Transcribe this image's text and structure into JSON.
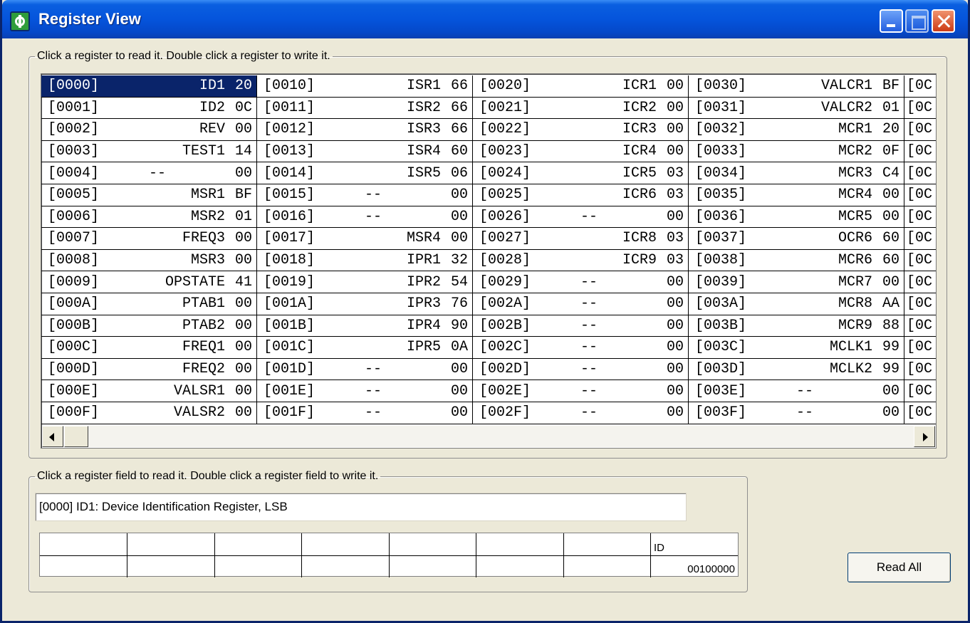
{
  "window": {
    "title": "Register View"
  },
  "register_group": {
    "caption": "Click a register to read it.  Double click a register to write it."
  },
  "registers": {
    "col1": [
      {
        "addr": "[0000]",
        "name": "ID1",
        "val": "20"
      },
      {
        "addr": "[0001]",
        "name": "ID2",
        "val": "0C"
      },
      {
        "addr": "[0002]",
        "name": "REV",
        "val": "00"
      },
      {
        "addr": "[0003]",
        "name": "TEST1",
        "val": "14"
      },
      {
        "addr": "[0004]",
        "name": "--",
        "val": "00"
      },
      {
        "addr": "[0005]",
        "name": "MSR1",
        "val": "BF"
      },
      {
        "addr": "[0006]",
        "name": "MSR2",
        "val": "01"
      },
      {
        "addr": "[0007]",
        "name": "FREQ3",
        "val": "00"
      },
      {
        "addr": "[0008]",
        "name": "MSR3",
        "val": "00"
      },
      {
        "addr": "[0009]",
        "name": "OPSTATE",
        "val": "41"
      },
      {
        "addr": "[000A]",
        "name": "PTAB1",
        "val": "00"
      },
      {
        "addr": "[000B]",
        "name": "PTAB2",
        "val": "00"
      },
      {
        "addr": "[000C]",
        "name": "FREQ1",
        "val": "00"
      },
      {
        "addr": "[000D]",
        "name": "FREQ2",
        "val": "00"
      },
      {
        "addr": "[000E]",
        "name": "VALSR1",
        "val": "00"
      },
      {
        "addr": "[000F]",
        "name": "VALSR2",
        "val": "00"
      }
    ],
    "col2": [
      {
        "addr": "[0010]",
        "name": "ISR1",
        "val": "66"
      },
      {
        "addr": "[0011]",
        "name": "ISR2",
        "val": "66"
      },
      {
        "addr": "[0012]",
        "name": "ISR3",
        "val": "66"
      },
      {
        "addr": "[0013]",
        "name": "ISR4",
        "val": "60"
      },
      {
        "addr": "[0014]",
        "name": "ISR5",
        "val": "06"
      },
      {
        "addr": "[0015]",
        "name": "--",
        "val": "00"
      },
      {
        "addr": "[0016]",
        "name": "--",
        "val": "00"
      },
      {
        "addr": "[0017]",
        "name": "MSR4",
        "val": "00"
      },
      {
        "addr": "[0018]",
        "name": "IPR1",
        "val": "32"
      },
      {
        "addr": "[0019]",
        "name": "IPR2",
        "val": "54"
      },
      {
        "addr": "[001A]",
        "name": "IPR3",
        "val": "76"
      },
      {
        "addr": "[001B]",
        "name": "IPR4",
        "val": "90"
      },
      {
        "addr": "[001C]",
        "name": "IPR5",
        "val": "0A"
      },
      {
        "addr": "[001D]",
        "name": "--",
        "val": "00"
      },
      {
        "addr": "[001E]",
        "name": "--",
        "val": "00"
      },
      {
        "addr": "[001F]",
        "name": "--",
        "val": "00"
      }
    ],
    "col3": [
      {
        "addr": "[0020]",
        "name": "ICR1",
        "val": "00"
      },
      {
        "addr": "[0021]",
        "name": "ICR2",
        "val": "00"
      },
      {
        "addr": "[0022]",
        "name": "ICR3",
        "val": "00"
      },
      {
        "addr": "[0023]",
        "name": "ICR4",
        "val": "00"
      },
      {
        "addr": "[0024]",
        "name": "ICR5",
        "val": "03"
      },
      {
        "addr": "[0025]",
        "name": "ICR6",
        "val": "03"
      },
      {
        "addr": "[0026]",
        "name": "--",
        "val": "00"
      },
      {
        "addr": "[0027]",
        "name": "ICR8",
        "val": "03"
      },
      {
        "addr": "[0028]",
        "name": "ICR9",
        "val": "03"
      },
      {
        "addr": "[0029]",
        "name": "--",
        "val": "00"
      },
      {
        "addr": "[002A]",
        "name": "--",
        "val": "00"
      },
      {
        "addr": "[002B]",
        "name": "--",
        "val": "00"
      },
      {
        "addr": "[002C]",
        "name": "--",
        "val": "00"
      },
      {
        "addr": "[002D]",
        "name": "--",
        "val": "00"
      },
      {
        "addr": "[002E]",
        "name": "--",
        "val": "00"
      },
      {
        "addr": "[002F]",
        "name": "--",
        "val": "00"
      }
    ],
    "col4": [
      {
        "addr": "[0030]",
        "name": "VALCR1",
        "val": "BF"
      },
      {
        "addr": "[0031]",
        "name": "VALCR2",
        "val": "01"
      },
      {
        "addr": "[0032]",
        "name": "MCR1",
        "val": "20"
      },
      {
        "addr": "[0033]",
        "name": "MCR2",
        "val": "0F"
      },
      {
        "addr": "[0034]",
        "name": "MCR3",
        "val": "C4"
      },
      {
        "addr": "[0035]",
        "name": "MCR4",
        "val": "00"
      },
      {
        "addr": "[0036]",
        "name": "MCR5",
        "val": "00"
      },
      {
        "addr": "[0037]",
        "name": "OCR6",
        "val": "60"
      },
      {
        "addr": "[0038]",
        "name": "MCR6",
        "val": "60"
      },
      {
        "addr": "[0039]",
        "name": "MCR7",
        "val": "00"
      },
      {
        "addr": "[003A]",
        "name": "MCR8",
        "val": "AA"
      },
      {
        "addr": "[003B]",
        "name": "MCR9",
        "val": "88"
      },
      {
        "addr": "[003C]",
        "name": "MCLK1",
        "val": "99"
      },
      {
        "addr": "[003D]",
        "name": "MCLK2",
        "val": "99"
      },
      {
        "addr": "[003E]",
        "name": "--",
        "val": "00"
      },
      {
        "addr": "[003F]",
        "name": "--",
        "val": "00"
      }
    ],
    "col5_partial": [
      "[0C",
      "[0C",
      "[0C",
      "[0C",
      "[0C",
      "[0C",
      "[0C",
      "[0C",
      "[0C",
      "[0C",
      "[0C",
      "[0C",
      "[0C",
      "[0C",
      "[0C",
      "[0C"
    ],
    "selected_index": 0
  },
  "field_group": {
    "caption": "Click a register field to read it.  Double click a register field to write it.",
    "description": "[0000] ID1: Device Identification Register, LSB",
    "bit_headers": [
      "",
      "",
      "",
      "",
      "",
      "",
      "",
      "ID"
    ],
    "bit_values": [
      "",
      "",
      "",
      "",
      "",
      "",
      "",
      "00100000"
    ]
  },
  "buttons": {
    "read_all": "Read All"
  },
  "icons": {
    "app": "app-icon",
    "minimize": "minimize-icon",
    "maximize": "maximize-icon",
    "close": "close-icon",
    "scroll_left": "scroll-left-arrow-icon",
    "scroll_right": "scroll-right-arrow-icon"
  }
}
